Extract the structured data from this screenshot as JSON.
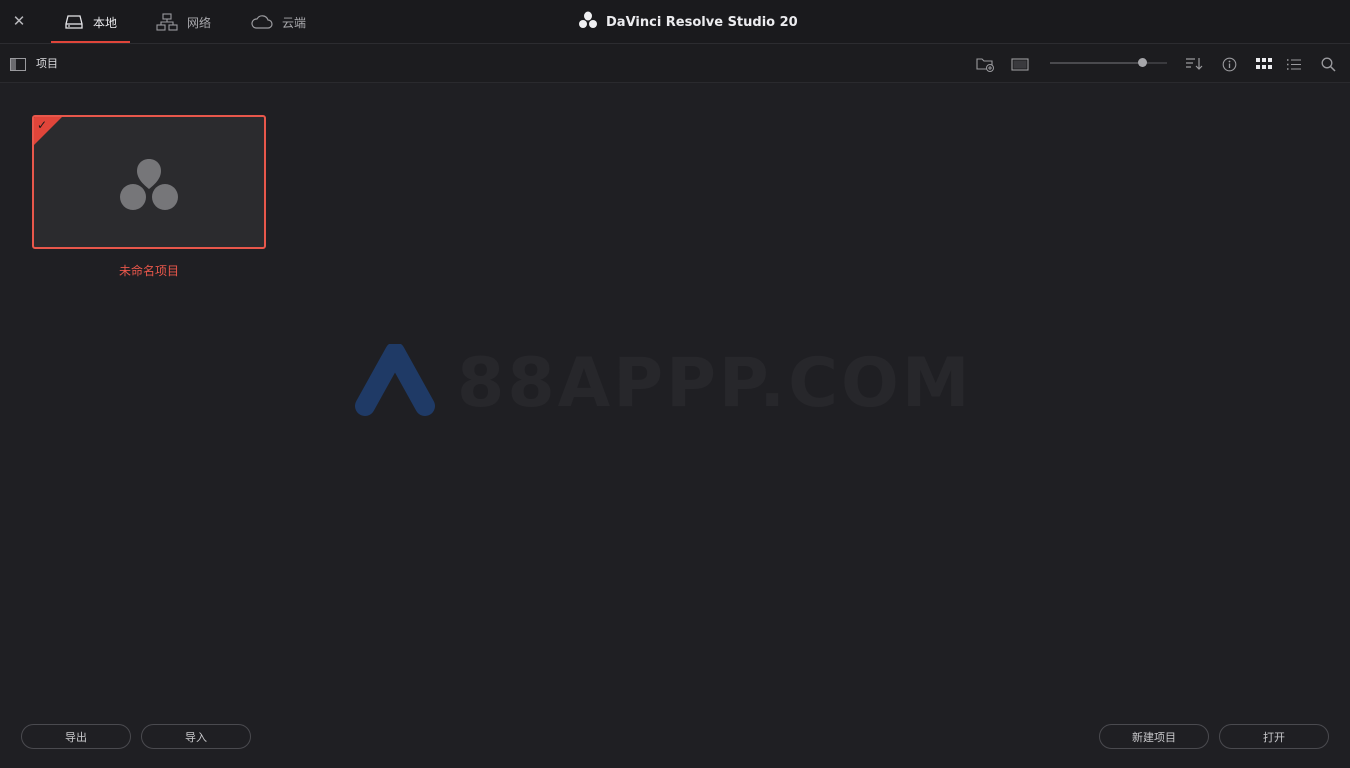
{
  "window": {
    "title": "DaVinci Resolve Studio 20",
    "close_glyph": "✕"
  },
  "tabs": [
    {
      "label": "本地",
      "icon": "local-drive-icon",
      "active": true
    },
    {
      "label": "网络",
      "icon": "network-icon",
      "active": false
    },
    {
      "label": "云端",
      "icon": "cloud-icon",
      "active": false
    }
  ],
  "toolbar": {
    "section_label": "项目",
    "icons": [
      "sidebar-toggle-icon",
      "new-folder-icon",
      "thumbnail-size-icon",
      "sort-icon",
      "info-icon",
      "grid-view-icon",
      "list-view-icon",
      "search-icon"
    ],
    "zoom_level": 0.79
  },
  "watermark": {
    "text": "88APPP.COM"
  },
  "projects": [
    {
      "name": "未命名项目",
      "selected": true
    }
  ],
  "footer": {
    "export_label": "导出",
    "import_label": "导入",
    "new_project_label": "新建项目",
    "open_label": "打开"
  },
  "colors": {
    "accent": "#e0453a",
    "background": "#1f1f23",
    "titlebar": "#1a1a1d"
  }
}
